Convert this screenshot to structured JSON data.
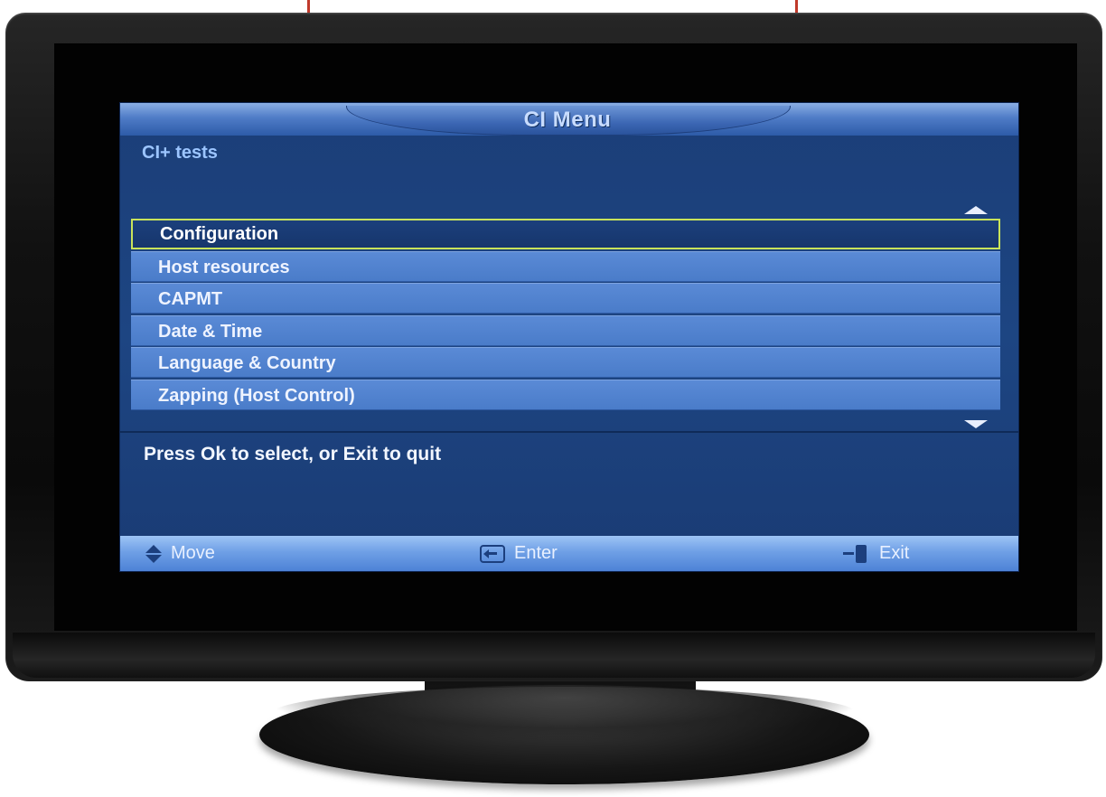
{
  "menu": {
    "title": "CI Menu",
    "subtitle": "CI+ tests",
    "items": [
      {
        "label": "Configuration",
        "selected": true
      },
      {
        "label": "Host resources",
        "selected": false
      },
      {
        "label": "CAPMT",
        "selected": false
      },
      {
        "label": "Date & Time",
        "selected": false
      },
      {
        "label": "Language & Country",
        "selected": false
      },
      {
        "label": "Zapping (Host Control)",
        "selected": false
      }
    ],
    "hint": "Press Ok to select, or Exit to quit"
  },
  "footer": {
    "move_label": "Move",
    "enter_label": "Enter",
    "exit_label": "Exit",
    "icons": [
      "up-down-arrows-icon",
      "enter-key-icon",
      "exit-door-icon"
    ]
  },
  "colors": {
    "panel_background": "#1d4582",
    "menu_item": "#4a7cc9",
    "selection_border": "#c9e35a",
    "footer_bar": "#6fa0e6"
  }
}
